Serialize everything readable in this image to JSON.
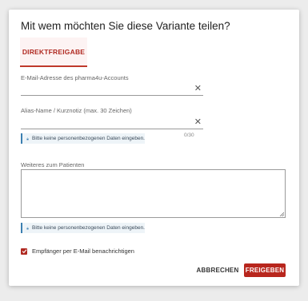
{
  "dialog": {
    "title": "Mit wem möchten Sie diese Variante teilen?",
    "tabs": [
      {
        "label": "DIREKTFREIGABE",
        "active": true
      }
    ]
  },
  "form": {
    "email": {
      "label": "E-Mail-Adresse des pharma4u-Accounts",
      "value": ""
    },
    "alias": {
      "label": "Alias-Name / Kurznotiz (max. 30 Zeichen)",
      "value": "",
      "counter": "0/30"
    },
    "info_hint": "Bitte keine personenbezogenen Daten eingeben.",
    "patient": {
      "label": "Weiteres zum Patienten",
      "value": ""
    },
    "notify": {
      "label": "Empfänger per E-Mail benachrichtigen",
      "checked": true
    }
  },
  "actions": {
    "cancel_label": "ABBRECHEN",
    "share_label": "FREIGEBEN"
  },
  "colors": {
    "accent": "#b8261d",
    "info_border": "#3b7fb1",
    "info_background": "#eef4f8"
  }
}
